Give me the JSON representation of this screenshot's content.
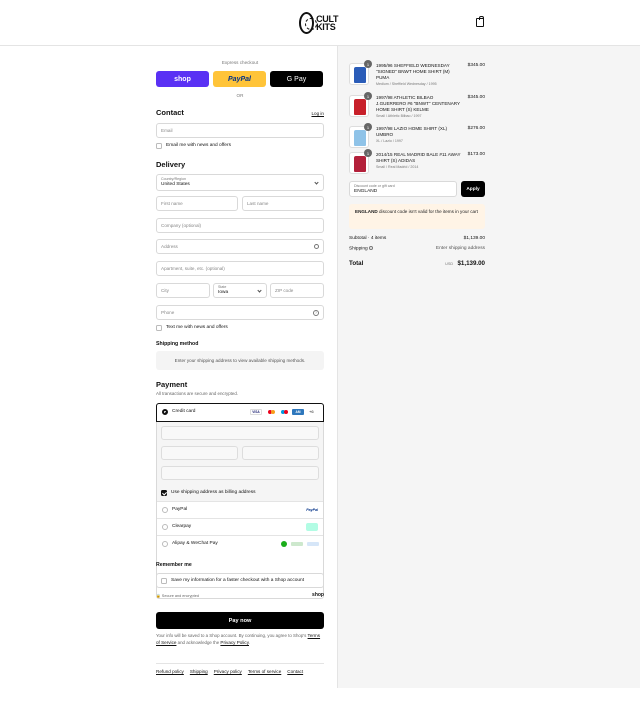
{
  "brand": {
    "name": "CULT KITS"
  },
  "checkout": {
    "express_label": "Express checkout",
    "shop_label": "shop",
    "paypal_label": "PayPal",
    "gpay_label": "G Pay",
    "or_label": "OR",
    "contact_title": "Contact",
    "login_label": "Log in",
    "email_placeholder": "Email",
    "email_news_label": "Email me with news and offers",
    "delivery_title": "Delivery",
    "country_label": "Country/Region",
    "country_value": "United States",
    "first_name": "First name",
    "last_name": "Last name",
    "company": "Company (optional)",
    "address": "Address",
    "apartment": "Apartment, suite, etc. (optional)",
    "city": "City",
    "state_label": "State",
    "state_value": "Iowa",
    "zip": "ZIP code",
    "phone": "Phone",
    "text_news_label": "Text me with news and offers",
    "shipping_title": "Shipping method",
    "shipping_notice": "Enter your shipping address to view available shipping methods.",
    "payment_title": "Payment",
    "payment_sub": "All transactions are secure and encrypted.",
    "credit_card": "Credit card",
    "card_more": "+6",
    "billing_same": "Use shipping address as billing address",
    "paypal_option": "PayPal",
    "clearpay_option": "Clearpay",
    "alipay_option": "Alipay & WeChat Pay",
    "remember_title": "Remember me",
    "remember_label": "Save my information for a faster checkout with a Shop account",
    "secure_label": "Secure and encrypted",
    "shop_small": "shop",
    "pay_now": "Pay now",
    "legal_1": "Your info will be saved to a Shop account. By continuing, you agree to Shop's",
    "legal_terms": "Terms of Service",
    "legal_2": "and acknowledge the",
    "legal_privacy": "Privacy Policy",
    "footer": [
      "Refund policy",
      "Shipping",
      "Privacy policy",
      "Terms of service",
      "Contact"
    ]
  },
  "order": {
    "items": [
      {
        "qty": "1",
        "title": "1995/96 SHEFFIELD WEDNESDAY \"SIGNED\" BNWT HOME SHIRT (M) PUMA",
        "sub": "Medium / Sheffield Wednesday / 1995",
        "price": "$345.00",
        "color": "#2a5cb8"
      },
      {
        "qty": "1",
        "title": "1997/98 ATHLETIC BILBAO J.GUERRERO #6 \"BNWT\" CENTENARY HOME SHIRT (S) KELME",
        "sub": "Small / Athletic Bilbao / 1997",
        "price": "$345.00",
        "color": "#c8202a"
      },
      {
        "qty": "1",
        "title": "1997/98 LAZIO HOME SHIRT (XL) UMBRO",
        "sub": "XL / Lazio / 1997",
        "price": "$276.00",
        "color": "#8fc3e8"
      },
      {
        "qty": "1",
        "title": "2014/15 REAL MADRID BALE #11 AWAY SHIRT (S) ADIDAS",
        "sub": "Small / Real Madrid / 2014",
        "price": "$173.00",
        "color": "#b3203a"
      }
    ],
    "discount_label": "Discount code or gift card",
    "discount_value": "ENGLAND",
    "apply_label": "Apply",
    "warning_code": "ENGLAND",
    "warning_text": "discount code isn't valid for the items in your cart",
    "subtotal_label": "Subtotal · 4 items",
    "subtotal_value": "$1,139.00",
    "shipping_label": "Shipping",
    "shipping_value": "Enter shipping address",
    "total_label": "Total",
    "currency": "USD",
    "total_value": "$1,139.00"
  },
  "colors": {
    "shop": "#5a31f4",
    "paypal": "#ffc439",
    "warning_bg": "#fff4e6"
  }
}
